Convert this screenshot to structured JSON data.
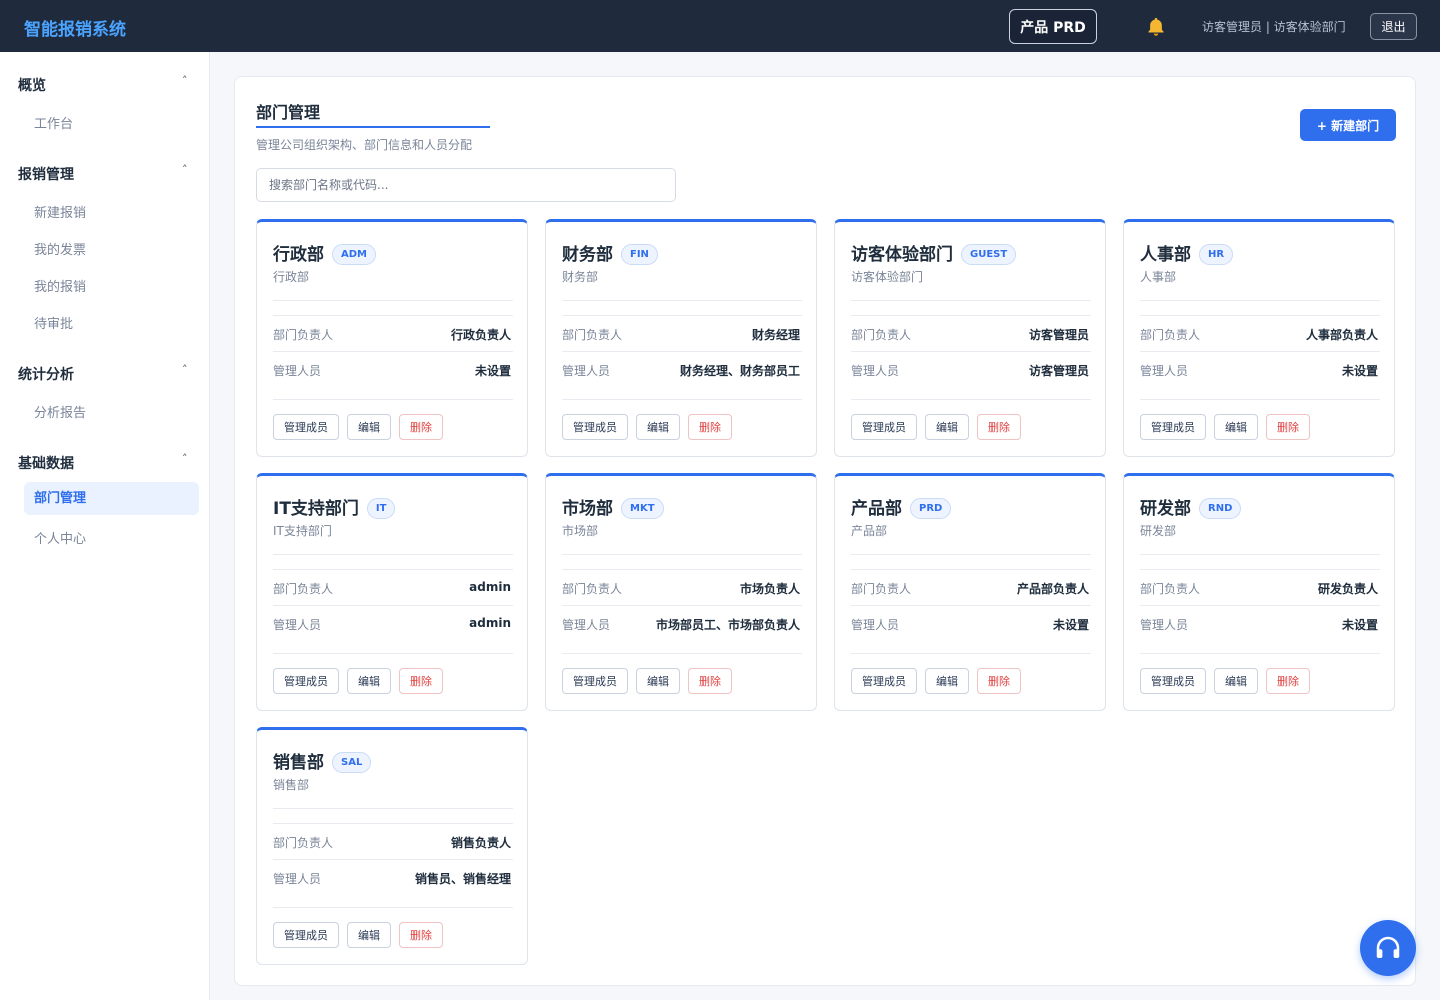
{
  "header": {
    "brand": "智能报销系统",
    "project_button": "产品 PRD",
    "user_info": "访客管理员 | 访客体验部门",
    "logout": "退出"
  },
  "sidebar": {
    "groups": [
      {
        "title": "概览",
        "items": [
          "工作台"
        ]
      },
      {
        "title": "报销管理",
        "items": [
          "新建报销",
          "我的发票",
          "我的报销",
          "待审批"
        ]
      },
      {
        "title": "统计分析",
        "items": [
          "分析报告"
        ]
      },
      {
        "title": "基础数据",
        "items": [
          "部门管理",
          "个人中心"
        ]
      }
    ],
    "caret": "˄"
  },
  "page": {
    "title": "部门管理",
    "subtitle": "管理公司组织架构、部门信息和人员分配",
    "new_button": "+ 新建部门",
    "search_placeholder": "搜索部门名称或代码..."
  },
  "labels": {
    "head": "部门负责人",
    "managers": "管理人员",
    "btn_members": "管理成员",
    "btn_edit": "编辑",
    "btn_delete": "删除"
  },
  "departments": [
    {
      "name": "行政部",
      "code": "ADM",
      "sub": "行政部",
      "head": "行政负责人",
      "managers": "未设置"
    },
    {
      "name": "财务部",
      "code": "FIN",
      "sub": "财务部",
      "head": "财务经理",
      "managers": "财务经理、财务部员工"
    },
    {
      "name": "访客体验部门",
      "code": "GUEST",
      "sub": "访客体验部门",
      "head": "访客管理员",
      "managers": "访客管理员"
    },
    {
      "name": "人事部",
      "code": "HR",
      "sub": "人事部",
      "head": "人事部负责人",
      "managers": "未设置"
    },
    {
      "name": "IT支持部门",
      "code": "IT",
      "sub": "IT支持部门",
      "head": "admin",
      "managers": "admin"
    },
    {
      "name": "市场部",
      "code": "MKT",
      "sub": "市场部",
      "head": "市场负责人",
      "managers": "市场部员工、市场部负责人"
    },
    {
      "name": "产品部",
      "code": "PRD",
      "sub": "产品部",
      "head": "产品部负责人",
      "managers": "未设置"
    },
    {
      "name": "研发部",
      "code": "RND",
      "sub": "研发部",
      "head": "研发负责人",
      "managers": "未设置"
    },
    {
      "name": "销售部",
      "code": "SAL",
      "sub": "销售部",
      "head": "销售负责人",
      "managers": "销售员、销售经理"
    }
  ],
  "colors": {
    "accent": "#2f6fed",
    "danger": "#e04040",
    "topbar": "#1f2a3d"
  }
}
